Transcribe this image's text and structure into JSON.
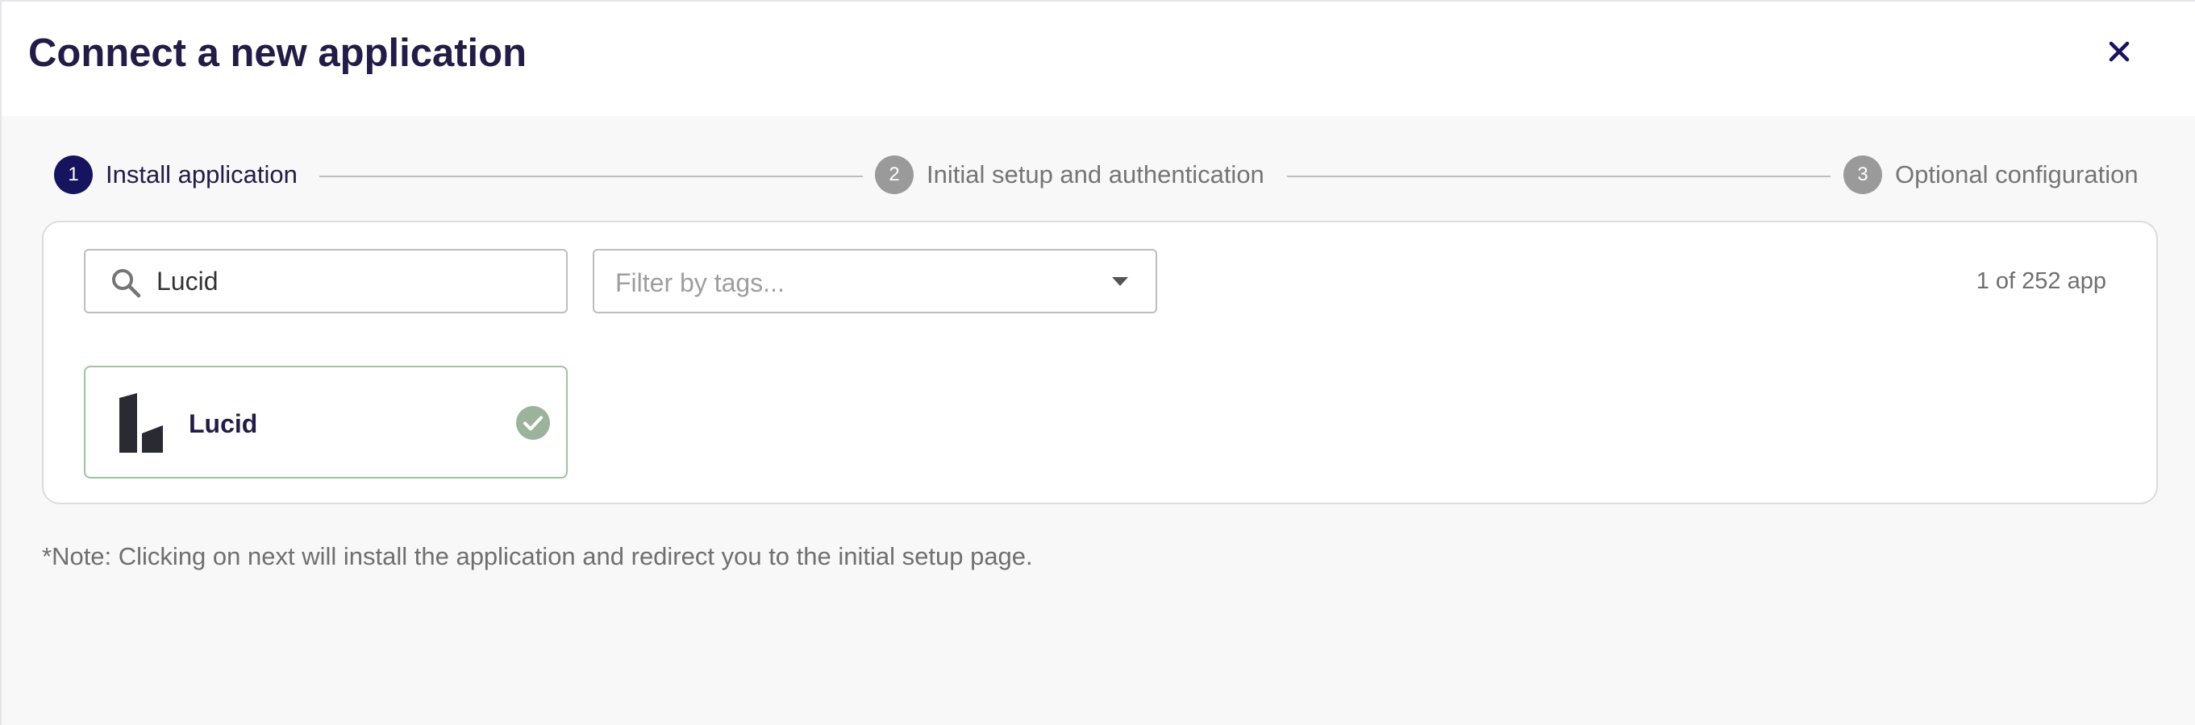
{
  "dialog": {
    "title": "Connect a new application",
    "close_icon": "close-icon"
  },
  "stepper": {
    "steps": [
      {
        "number": "1",
        "label": "Install application",
        "state": "active"
      },
      {
        "number": "2",
        "label": "Initial setup and authentication",
        "state": "inactive"
      },
      {
        "number": "3",
        "label": "Optional configuration",
        "state": "inactive"
      }
    ]
  },
  "search": {
    "value": "Lucid",
    "icon": "search-icon"
  },
  "tag_filter": {
    "placeholder": "Filter by tags...",
    "icon": "caret-down-icon"
  },
  "results": {
    "count_text": "1 of 252 app",
    "apps": [
      {
        "name": "Lucid",
        "logo": "lucid-logo",
        "selected": true,
        "status_icon": "check-circle-icon"
      }
    ]
  },
  "note": "*Note: Clicking on next will install the application and redirect you to the initial setup page.",
  "colors": {
    "primary": "#16135f",
    "title_text": "#221c46",
    "inactive_step": "#9a9a9a",
    "selected_border": "#9bc59b",
    "check_badge": "#9bb39b"
  }
}
